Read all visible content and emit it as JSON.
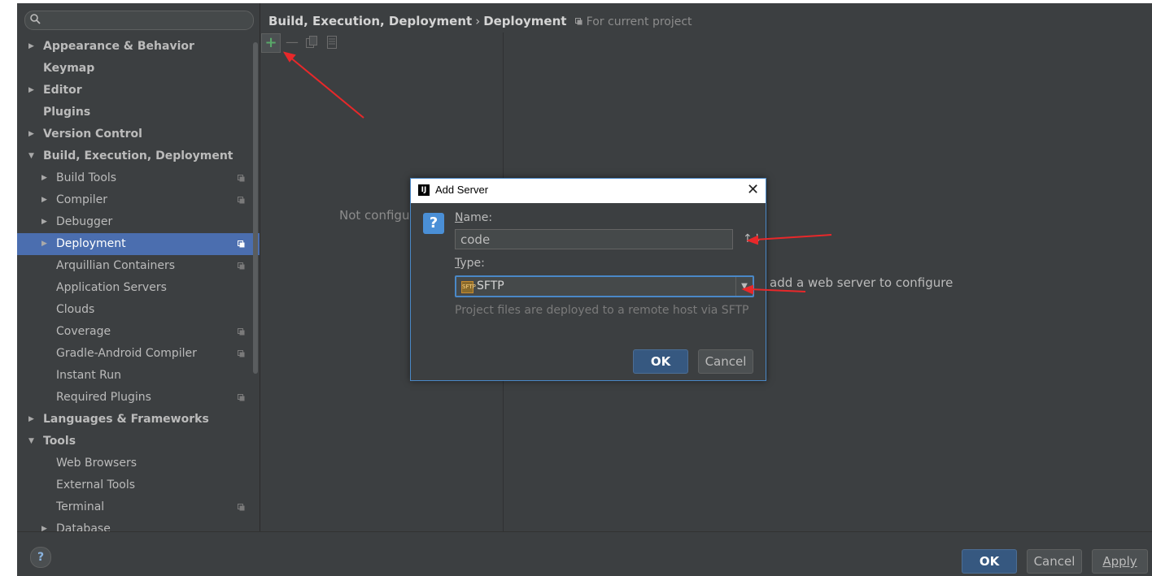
{
  "breadcrumb": {
    "section": "Build, Execution, Deployment",
    "separator": "›",
    "page": "Deployment",
    "scope": "For current project"
  },
  "search": {
    "value": ""
  },
  "tree": [
    {
      "label": "Appearance & Behavior",
      "level": 0,
      "arrow": "right",
      "bold": true
    },
    {
      "label": "Keymap",
      "level": 0,
      "arrow": "",
      "bold": true
    },
    {
      "label": "Editor",
      "level": 0,
      "arrow": "right",
      "bold": true
    },
    {
      "label": "Plugins",
      "level": 0,
      "arrow": "",
      "bold": true
    },
    {
      "label": "Version Control",
      "level": 0,
      "arrow": "right",
      "bold": true
    },
    {
      "label": "Build, Execution, Deployment",
      "level": 0,
      "arrow": "down",
      "bold": true
    },
    {
      "label": "Build Tools",
      "level": 1,
      "arrow": "right",
      "proj": true
    },
    {
      "label": "Compiler",
      "level": 1,
      "arrow": "right",
      "proj": true
    },
    {
      "label": "Debugger",
      "level": 1,
      "arrow": "right"
    },
    {
      "label": "Deployment",
      "level": 1,
      "arrow": "right",
      "proj": true,
      "selected": true
    },
    {
      "label": "Arquillian Containers",
      "level": 1,
      "arrow": "",
      "proj": true
    },
    {
      "label": "Application Servers",
      "level": 1,
      "arrow": ""
    },
    {
      "label": "Clouds",
      "level": 1,
      "arrow": ""
    },
    {
      "label": "Coverage",
      "level": 1,
      "arrow": "",
      "proj": true
    },
    {
      "label": "Gradle-Android Compiler",
      "level": 1,
      "arrow": "",
      "proj": true
    },
    {
      "label": "Instant Run",
      "level": 1,
      "arrow": ""
    },
    {
      "label": "Required Plugins",
      "level": 1,
      "arrow": "",
      "proj": true
    },
    {
      "label": "Languages & Frameworks",
      "level": 0,
      "arrow": "right",
      "bold": true
    },
    {
      "label": "Tools",
      "level": 0,
      "arrow": "down",
      "bold": true
    },
    {
      "label": "Web Browsers",
      "level": 1,
      "arrow": ""
    },
    {
      "label": "External Tools",
      "level": 1,
      "arrow": ""
    },
    {
      "label": "Terminal",
      "level": 1,
      "arrow": "",
      "proj": true
    },
    {
      "label": "Database",
      "level": 1,
      "arrow": "right"
    }
  ],
  "toolbar": {
    "add": "+",
    "remove": "—"
  },
  "main": {
    "not_configured": "Not configur",
    "add_hint": "add a web server to configure"
  },
  "dialog": {
    "title": "Add Server",
    "app_icon": "IJ",
    "close": "✕",
    "question_icon": "?",
    "name_label_mnemonic": "N",
    "name_label_rest": "ame:",
    "name_value": "code",
    "sort_icon": "↑↓",
    "type_label_mnemonic": "T",
    "type_label_rest": "ype:",
    "type_value": "SFTP",
    "type_icon_text": "SFTP",
    "hint": "Project files are deployed to a remote host via SFTP",
    "ok": "OK",
    "cancel": "Cancel"
  },
  "footer": {
    "help": "?",
    "ok": "OK",
    "cancel": "Cancel",
    "apply": "Apply"
  },
  "colors": {
    "background": "#3c3f41",
    "selection": "#4b6eaf",
    "accent_border": "#4a88c7",
    "annotation_arrow": "#e8282a",
    "add_icon": "#59a869"
  }
}
